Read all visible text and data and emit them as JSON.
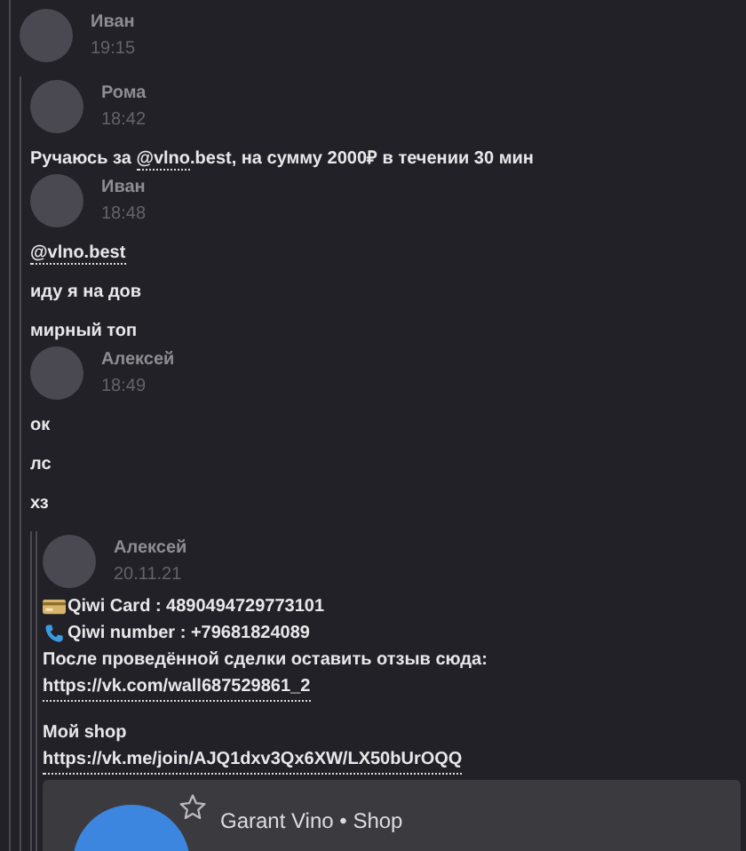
{
  "message": {
    "author": "Иван",
    "time": "19:15",
    "forwarded": [
      {
        "author": "Рома",
        "time": "18:42",
        "texts": [
          [
            {
              "kind": "plain",
              "text": "Ручаюсь за "
            },
            {
              "kind": "mention",
              "text": "@vlno"
            },
            {
              "kind": "plain",
              "text": ".best, на сумму 2000₽ в течении 30 мин"
            }
          ]
        ]
      },
      {
        "author": "Иван",
        "time": "18:48",
        "texts": [
          [
            {
              "kind": "mention",
              "text": "@vlno.best"
            }
          ],
          [
            {
              "kind": "plain",
              "text": "иду я на дов"
            }
          ],
          [
            {
              "kind": "plain",
              "text": "мирный топ"
            }
          ]
        ]
      },
      {
        "author": "Алексей",
        "time": "18:49",
        "texts": [
          [
            {
              "kind": "plain",
              "text": "ок"
            }
          ],
          [
            {
              "kind": "plain",
              "text": "лс"
            }
          ],
          [
            {
              "kind": "plain",
              "text": "хз"
            }
          ]
        ],
        "forwarded": [
          {
            "author": "Алексей",
            "time": "20.11.21",
            "lines": [
              {
                "kind": "card",
                "text": "Qiwi Card : 4890494729773101"
              },
              {
                "kind": "phone",
                "text": "Qiwi number : +79681824089"
              },
              {
                "kind": "text",
                "text": "После проведённой сделки оставить отзыв сюда:"
              },
              {
                "kind": "link",
                "text": "https://vk.com/wall687529861_2"
              },
              {
                "kind": "blank"
              },
              {
                "kind": "text",
                "text": "Мой shop"
              },
              {
                "kind": "link",
                "text": "https://vk.me/join/AJQ1dxv3Qx6XW/LX50bUrOQQ"
              }
            ],
            "link_card": {
              "title": "Garant Vino • Shop"
            }
          }
        ]
      }
    ]
  }
}
